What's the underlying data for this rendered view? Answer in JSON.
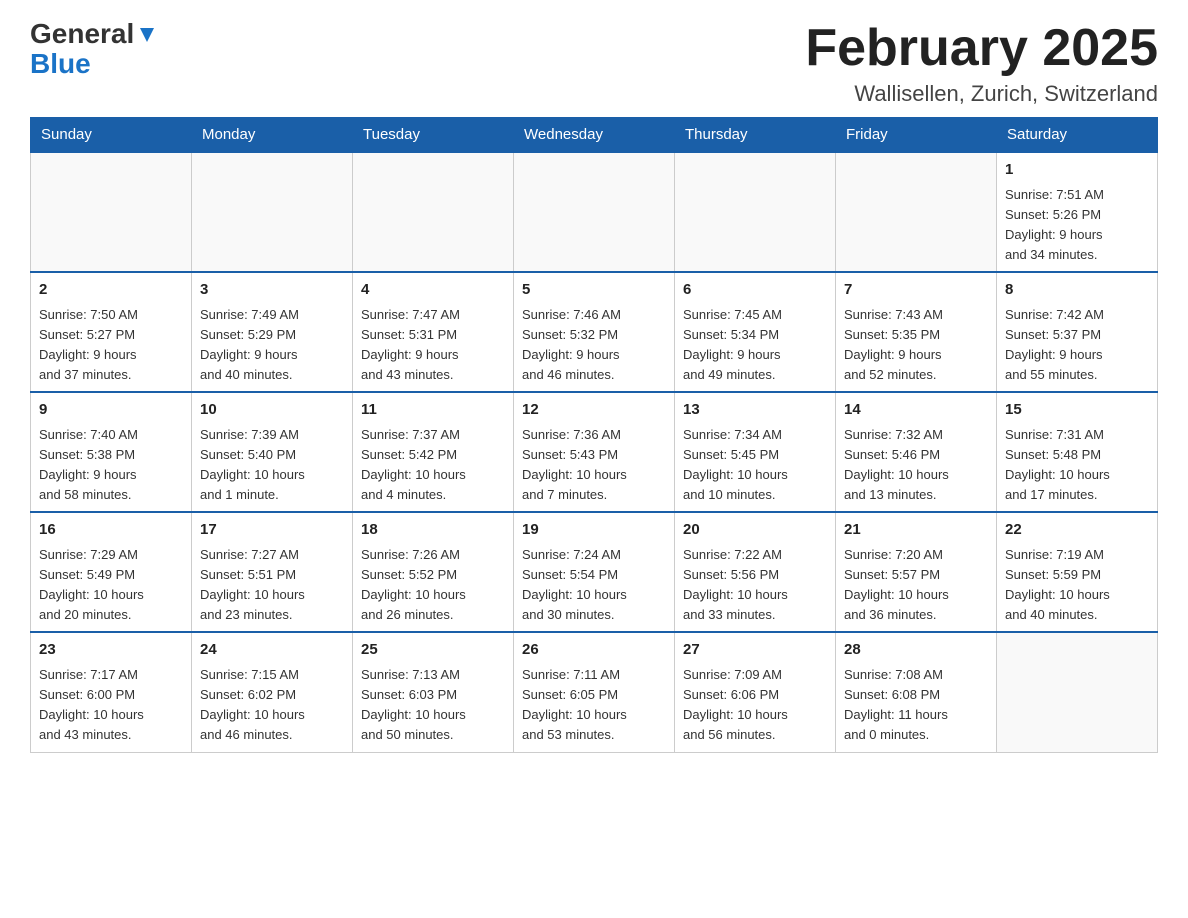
{
  "header": {
    "logo_general": "General",
    "logo_blue": "Blue",
    "month": "February 2025",
    "location": "Wallisellen, Zurich, Switzerland"
  },
  "days_of_week": [
    "Sunday",
    "Monday",
    "Tuesday",
    "Wednesday",
    "Thursday",
    "Friday",
    "Saturday"
  ],
  "weeks": [
    {
      "days": [
        {
          "num": "",
          "info": ""
        },
        {
          "num": "",
          "info": ""
        },
        {
          "num": "",
          "info": ""
        },
        {
          "num": "",
          "info": ""
        },
        {
          "num": "",
          "info": ""
        },
        {
          "num": "",
          "info": ""
        },
        {
          "num": "1",
          "info": "Sunrise: 7:51 AM\nSunset: 5:26 PM\nDaylight: 9 hours\nand 34 minutes."
        }
      ]
    },
    {
      "days": [
        {
          "num": "2",
          "info": "Sunrise: 7:50 AM\nSunset: 5:27 PM\nDaylight: 9 hours\nand 37 minutes."
        },
        {
          "num": "3",
          "info": "Sunrise: 7:49 AM\nSunset: 5:29 PM\nDaylight: 9 hours\nand 40 minutes."
        },
        {
          "num": "4",
          "info": "Sunrise: 7:47 AM\nSunset: 5:31 PM\nDaylight: 9 hours\nand 43 minutes."
        },
        {
          "num": "5",
          "info": "Sunrise: 7:46 AM\nSunset: 5:32 PM\nDaylight: 9 hours\nand 46 minutes."
        },
        {
          "num": "6",
          "info": "Sunrise: 7:45 AM\nSunset: 5:34 PM\nDaylight: 9 hours\nand 49 minutes."
        },
        {
          "num": "7",
          "info": "Sunrise: 7:43 AM\nSunset: 5:35 PM\nDaylight: 9 hours\nand 52 minutes."
        },
        {
          "num": "8",
          "info": "Sunrise: 7:42 AM\nSunset: 5:37 PM\nDaylight: 9 hours\nand 55 minutes."
        }
      ]
    },
    {
      "days": [
        {
          "num": "9",
          "info": "Sunrise: 7:40 AM\nSunset: 5:38 PM\nDaylight: 9 hours\nand 58 minutes."
        },
        {
          "num": "10",
          "info": "Sunrise: 7:39 AM\nSunset: 5:40 PM\nDaylight: 10 hours\nand 1 minute."
        },
        {
          "num": "11",
          "info": "Sunrise: 7:37 AM\nSunset: 5:42 PM\nDaylight: 10 hours\nand 4 minutes."
        },
        {
          "num": "12",
          "info": "Sunrise: 7:36 AM\nSunset: 5:43 PM\nDaylight: 10 hours\nand 7 minutes."
        },
        {
          "num": "13",
          "info": "Sunrise: 7:34 AM\nSunset: 5:45 PM\nDaylight: 10 hours\nand 10 minutes."
        },
        {
          "num": "14",
          "info": "Sunrise: 7:32 AM\nSunset: 5:46 PM\nDaylight: 10 hours\nand 13 minutes."
        },
        {
          "num": "15",
          "info": "Sunrise: 7:31 AM\nSunset: 5:48 PM\nDaylight: 10 hours\nand 17 minutes."
        }
      ]
    },
    {
      "days": [
        {
          "num": "16",
          "info": "Sunrise: 7:29 AM\nSunset: 5:49 PM\nDaylight: 10 hours\nand 20 minutes."
        },
        {
          "num": "17",
          "info": "Sunrise: 7:27 AM\nSunset: 5:51 PM\nDaylight: 10 hours\nand 23 minutes."
        },
        {
          "num": "18",
          "info": "Sunrise: 7:26 AM\nSunset: 5:52 PM\nDaylight: 10 hours\nand 26 minutes."
        },
        {
          "num": "19",
          "info": "Sunrise: 7:24 AM\nSunset: 5:54 PM\nDaylight: 10 hours\nand 30 minutes."
        },
        {
          "num": "20",
          "info": "Sunrise: 7:22 AM\nSunset: 5:56 PM\nDaylight: 10 hours\nand 33 minutes."
        },
        {
          "num": "21",
          "info": "Sunrise: 7:20 AM\nSunset: 5:57 PM\nDaylight: 10 hours\nand 36 minutes."
        },
        {
          "num": "22",
          "info": "Sunrise: 7:19 AM\nSunset: 5:59 PM\nDaylight: 10 hours\nand 40 minutes."
        }
      ]
    },
    {
      "days": [
        {
          "num": "23",
          "info": "Sunrise: 7:17 AM\nSunset: 6:00 PM\nDaylight: 10 hours\nand 43 minutes."
        },
        {
          "num": "24",
          "info": "Sunrise: 7:15 AM\nSunset: 6:02 PM\nDaylight: 10 hours\nand 46 minutes."
        },
        {
          "num": "25",
          "info": "Sunrise: 7:13 AM\nSunset: 6:03 PM\nDaylight: 10 hours\nand 50 minutes."
        },
        {
          "num": "26",
          "info": "Sunrise: 7:11 AM\nSunset: 6:05 PM\nDaylight: 10 hours\nand 53 minutes."
        },
        {
          "num": "27",
          "info": "Sunrise: 7:09 AM\nSunset: 6:06 PM\nDaylight: 10 hours\nand 56 minutes."
        },
        {
          "num": "28",
          "info": "Sunrise: 7:08 AM\nSunset: 6:08 PM\nDaylight: 11 hours\nand 0 minutes."
        },
        {
          "num": "",
          "info": ""
        }
      ]
    }
  ]
}
